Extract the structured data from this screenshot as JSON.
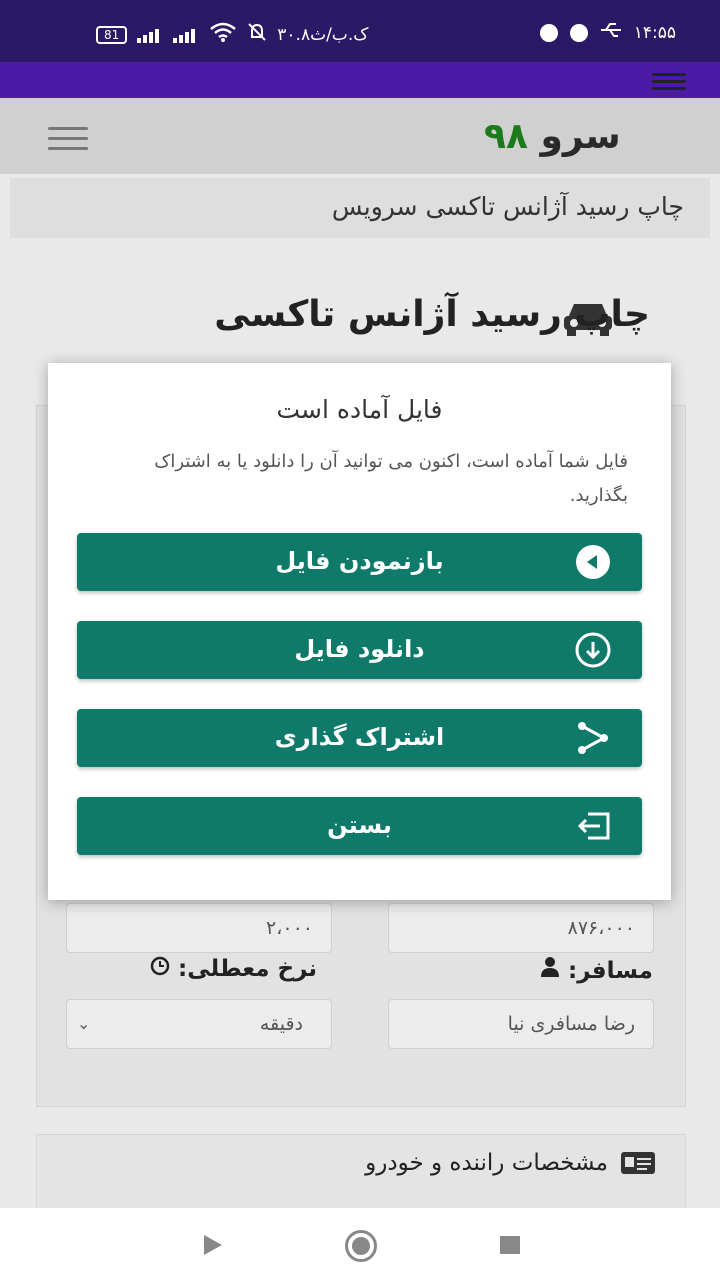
{
  "status_bar": {
    "battery": "81",
    "speed": "۳۰.۸ک.ب/ث",
    "time": "۱۴:۵۵"
  },
  "header": {
    "logo_text": "سرو",
    "logo_number": "۹۸"
  },
  "breadcrumb": "چاپ رسید آژانس تاکسی سرویس",
  "page": {
    "title": "چاپ رسید آژانس تاکسی",
    "fields": {
      "left_value": "۲،۰۰۰",
      "right_value": "۸۷۶،۰۰۰",
      "rate_label": "نرخ معطلی:",
      "passenger_label": "مسافر:",
      "rate_select": "دقیقه",
      "passenger_value": "رضا مسافری نیا"
    },
    "section_title": "مشخصات راننده و خودرو"
  },
  "modal": {
    "title": "فایل آماده است",
    "message": "فایل شما آماده است، اکنون می توانید آن را دانلود یا به اشتراک بگذارید.",
    "buttons": {
      "open": "بازنمودن فایل",
      "download": "دانلود فایل",
      "share": "اشتراک گذاری",
      "close": "بستن"
    }
  },
  "colors": {
    "status_bar": "#2a1a66",
    "accent_purple": "#4b1aa6",
    "button_green": "#0f7a6a",
    "logo_green": "#1c7a1c"
  }
}
